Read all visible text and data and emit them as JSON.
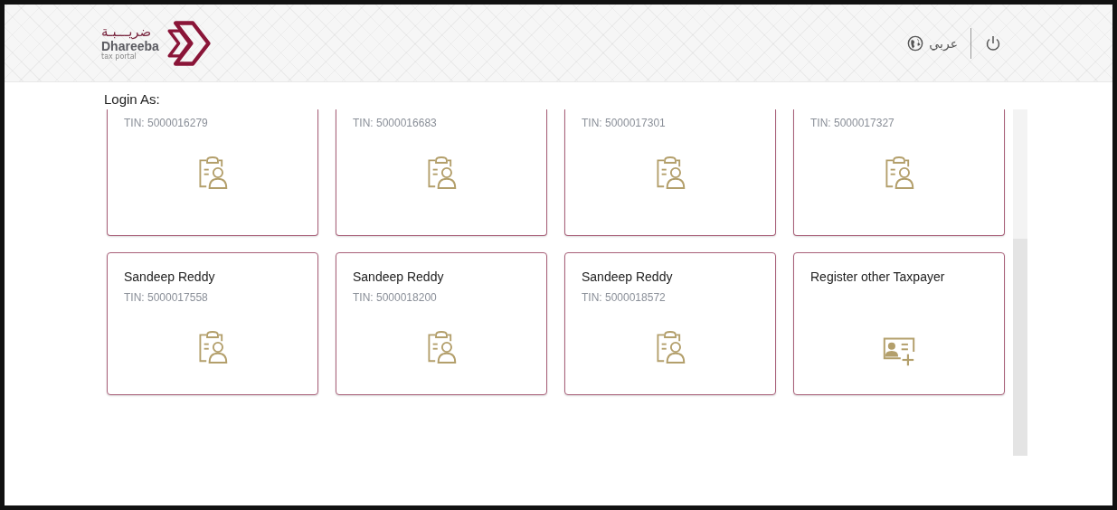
{
  "header": {
    "logo": {
      "arabic": "ضريـــبـة",
      "name": "Dhareeba",
      "tagline": "tax portal"
    },
    "language": "عربي"
  },
  "login_label": "Login As:",
  "cards": [
    {
      "kind": "clipped",
      "tin": "TIN: 5000016279"
    },
    {
      "kind": "clipped",
      "tin": "TIN: 5000016683"
    },
    {
      "kind": "clipped",
      "tin": "TIN: 5000017301"
    },
    {
      "kind": "clipped",
      "tin": "TIN: 5000017327"
    },
    {
      "kind": "taxpayer",
      "name": "Sandeep Reddy",
      "tin": "TIN: 5000017558"
    },
    {
      "kind": "taxpayer",
      "name": "Sandeep Reddy",
      "tin": "TIN: 5000018200"
    },
    {
      "kind": "taxpayer",
      "name": "Sandeep Reddy",
      "tin": "TIN: 5000018572"
    },
    {
      "kind": "register",
      "name": "Register other Taxpayer"
    }
  ]
}
